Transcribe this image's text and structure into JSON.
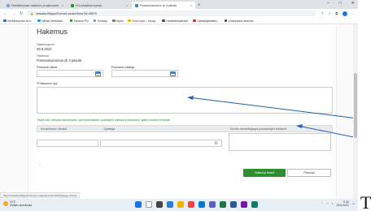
{
  "browser": {
    "tabs": [
      {
        "label": "Henkilökunnan vakanssi- ja sijaisuudet"
      },
      {
        "label": "HO-lomakkeet kysely"
      },
      {
        "label": "Poissaoloanomus yli 3 päivää"
      }
    ],
    "new_tab": "+",
    "window_controls": [
      "–",
      "□",
      "✕"
    ],
    "url": "tavastia.fi/Apps/Forms/Lomake/New?id=45070",
    "bookmarks": [
      {
        "label": "Henkilökunnan sivu...",
        "color": "#2b6cb0"
      },
      {
        "label": "Wilma Henkilöstö...",
        "color": "#1d9bf0"
      },
      {
        "label": "Sanoma Pro",
        "color": "#2f8f2f"
      },
      {
        "label": "Eduhelp",
        "color": "#5aa0d8"
      },
      {
        "label": "Alpha",
        "color": "#777777"
      },
      {
        "label": "Oma Drive – Googl...",
        "color": "#f2b300"
      },
      {
        "label": "Henkilöstöpalvelut",
        "color": "#4a4a4a"
      },
      {
        "label": "Opiskelijahallinto...",
        "color": "#c0392b"
      },
      {
        "label": "Koulutuksen tiedotus...",
        "color": "#4a4a4a"
      }
    ]
  },
  "form": {
    "title": "Hakemus",
    "date_label": "Hakemuspvm",
    "date_value": "26.8.2022",
    "type_label": "Hakemus",
    "type_value": "Poissaoloanomus yli 3 päivää",
    "start_label": "Poissaolo alkaa",
    "end_label": "Poissaolo päättyy",
    "reason_label": "*Poissaolon syy",
    "teachers_heading": "Täytä alle olevaan taulukkoon opintokerrattain opettajien kanssa poissaolon ajalle sovitut tehtävät",
    "table_headers": [
      "Kurssi/osion, Moduli",
      "Opettaja",
      "Sovittu menettelytapa poissaolojen tehtäviä"
    ],
    "save_button": "Tallenna tiedot",
    "cancel_button": "Peruuta"
  },
  "status_url": "https://tavastia.fi/Apps/Forms/Lomake/New?id=45070#page-content",
  "taskbar": {
    "weather_temp": "19°C",
    "weather_desc": "Osittain aurinkoista",
    "time": "9.46",
    "date": "24.8.2022"
  },
  "side_letter": "T",
  "colors": {
    "accent_green": "#2f8f2f",
    "calendar_blue": "#3f82c4",
    "arrow_blue": "#1f5fb5"
  }
}
